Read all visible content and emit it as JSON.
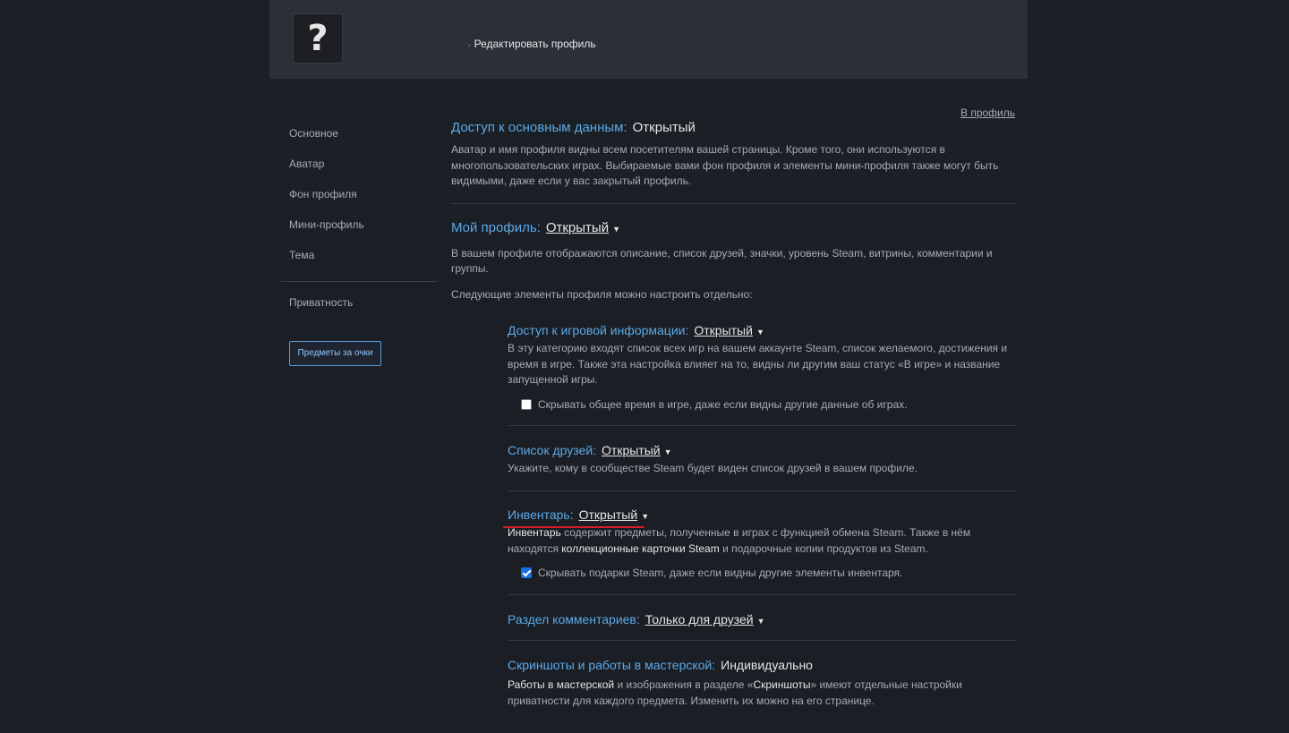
{
  "header": {
    "avatar_glyph": "?",
    "edit_profile": "Редактировать профиль"
  },
  "nav": {
    "items": [
      "Основное",
      "Аватар",
      "Фон профиля",
      "Мини-профиль",
      "Тема"
    ],
    "privacy": "Приватность",
    "points_button": "Предметы за очки"
  },
  "back_link": "В профиль",
  "basic": {
    "title": "Доступ к основным данным:",
    "value": "Открытый",
    "desc": "Аватар и имя профиля видны всем посетителям вашей страницы. Кроме того, они используются в многопользовательских играх. Выбираемые вами фон профиля и элементы мини-профиля также могут быть видимыми, даже если у вас закрытый профиль."
  },
  "my_profile": {
    "title": "Мой профиль:",
    "value": "Открытый",
    "desc": "В вашем профиле отображаются описание, список друзей, значки, уровень Steam, витрины, комментарии и группы.",
    "note": "Следующие элементы профиля можно настроить отдельно:"
  },
  "game_info": {
    "title": "Доступ к игровой информации:",
    "value": "Открытый",
    "desc": "В эту категорию входят список всех игр на вашем аккаунте Steam, список желаемого, достижения и время в игре. Также эта настройка влияет на то, видны ли другим ваш статус «В игре» и название запущенной игры.",
    "checkbox": "Скрывать общее время в игре, даже если видны другие данные об играх.",
    "checked": false
  },
  "friends": {
    "title": "Список друзей:",
    "value": "Открытый",
    "desc": "Укажите, кому в сообществе Steam будет виден список друзей в вашем профиле."
  },
  "inventory": {
    "title": "Инвентарь:",
    "value": "Открытый",
    "desc_b1": "Инвентарь",
    "desc_t1": " содержит предметы, полученные в играх с функцией обмена Steam. Также в нём находятся ",
    "desc_b2": "коллекционные карточки Steam",
    "desc_t2": " и подарочные копии продуктов из Steam.",
    "checkbox": "Скрывать подарки Steam, даже если видны другие элементы инвентаря.",
    "checked": true
  },
  "comments": {
    "title": "Раздел комментариев:",
    "value": "Только для друзей"
  },
  "screenshots": {
    "title": "Скриншоты и работы в мастерской:",
    "value": "Индивидуально",
    "desc_b1": "Работы в мастерской",
    "desc_t1": " и изображения в разделе «",
    "desc_b2": "Скриншоты",
    "desc_t2": "» имеют отдельные настройки приватности для каждого предмета. Изменить их можно на его странице."
  },
  "colors": {
    "accent": "#5ca9e8",
    "highlight_underline": "#d51d2b",
    "checkbox_on": "#1a6fe3"
  }
}
